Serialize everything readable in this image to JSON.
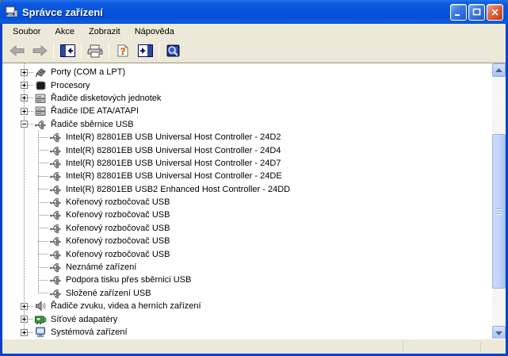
{
  "window": {
    "title": "Správce zařízení",
    "controls": [
      {
        "name": "minimize-button",
        "icon": "minimize-icon"
      },
      {
        "name": "maximize-button",
        "icon": "maximize-icon"
      },
      {
        "name": "close-button",
        "icon": "close-icon"
      }
    ]
  },
  "colors": {
    "titlebar_blue": "#0855dd",
    "chrome": "#ece9d8",
    "close_red": "#d6502f",
    "tree_background": "#ffffff"
  },
  "menu": {
    "items": [
      {
        "name": "menu-soubor",
        "label": "Soubor"
      },
      {
        "name": "menu-akce",
        "label": "Akce"
      },
      {
        "name": "menu-zobrazit",
        "label": "Zobrazit"
      },
      {
        "name": "menu-napoveda",
        "label": "Nápověda"
      }
    ]
  },
  "toolbar": {
    "buttons": [
      {
        "name": "back-button",
        "icon": "back-arrow-icon",
        "disabled": true
      },
      {
        "name": "forward-button",
        "icon": "forward-arrow-icon",
        "disabled": true
      },
      {
        "type": "separator"
      },
      {
        "name": "hide-console-tree-button",
        "icon": "hide-tree-panel-icon"
      },
      {
        "type": "separator"
      },
      {
        "name": "print-button",
        "icon": "printer-icon"
      },
      {
        "type": "separator"
      },
      {
        "name": "help-button",
        "icon": "help-icon"
      },
      {
        "name": "show-action-pane-button",
        "icon": "show-pane-panel-icon"
      },
      {
        "type": "separator"
      },
      {
        "name": "scan-hardware-changes-button",
        "icon": "scan-hardware-icon"
      }
    ]
  },
  "tree": {
    "items": [
      {
        "label": "Porty (COM a LPT)",
        "icon": "port-icon",
        "level": 0,
        "expand": "plus"
      },
      {
        "label": "Procesory",
        "icon": "cpu-icon",
        "level": 0,
        "expand": "plus"
      },
      {
        "label": "Řadiče disketových jednotek",
        "icon": "controller-icon",
        "level": 0,
        "expand": "plus"
      },
      {
        "label": "Řadiče IDE ATA/ATAPI",
        "icon": "controller-icon",
        "level": 0,
        "expand": "plus"
      },
      {
        "label": "Řadiče sběrnice USB",
        "icon": "usb-icon",
        "level": 0,
        "expand": "minus"
      },
      {
        "label": "Intel(R) 82801EB USB Universal Host Controller - 24D2",
        "icon": "usb-icon",
        "level": 1
      },
      {
        "label": "Intel(R) 82801EB USB Universal Host Controller - 24D4",
        "icon": "usb-icon",
        "level": 1
      },
      {
        "label": "Intel(R) 82801EB USB Universal Host Controller - 24D7",
        "icon": "usb-icon",
        "level": 1
      },
      {
        "label": "Intel(R) 82801EB USB Universal Host Controller - 24DE",
        "icon": "usb-icon",
        "level": 1
      },
      {
        "label": "Intel(R) 82801EB USB2 Enhanced Host Controller - 24DD",
        "icon": "usb-icon",
        "level": 1
      },
      {
        "label": "Kořenový rozbočovač USB",
        "icon": "usb-icon",
        "level": 1
      },
      {
        "label": "Kořenový rozbočovač USB",
        "icon": "usb-icon",
        "level": 1
      },
      {
        "label": "Kořenový rozbočovač USB",
        "icon": "usb-icon",
        "level": 1
      },
      {
        "label": "Kořenový rozbočovač USB",
        "icon": "usb-icon",
        "level": 1
      },
      {
        "label": "Kořenový rozbočovač USB",
        "icon": "usb-icon",
        "level": 1
      },
      {
        "label": "Neznámé zařízení",
        "icon": "usb-icon",
        "level": 1
      },
      {
        "label": "Podpora tisku přes sběrnici USB",
        "icon": "usb-icon",
        "level": 1
      },
      {
        "label": "Složené zařízení USB",
        "icon": "usb-icon",
        "level": 1
      },
      {
        "label": "Řadiče zvuku, videa a herních zařízení",
        "icon": "audio-icon",
        "level": 0,
        "expand": "plus"
      },
      {
        "label": "Síťové adapatéry",
        "icon": "network-adapter-icon",
        "level": 0,
        "expand": "plus"
      },
      {
        "label": "Systémová zařízení",
        "icon": "system-device-icon",
        "level": 0,
        "expand": "plus"
      }
    ]
  },
  "statusbar": {
    "text": ""
  }
}
